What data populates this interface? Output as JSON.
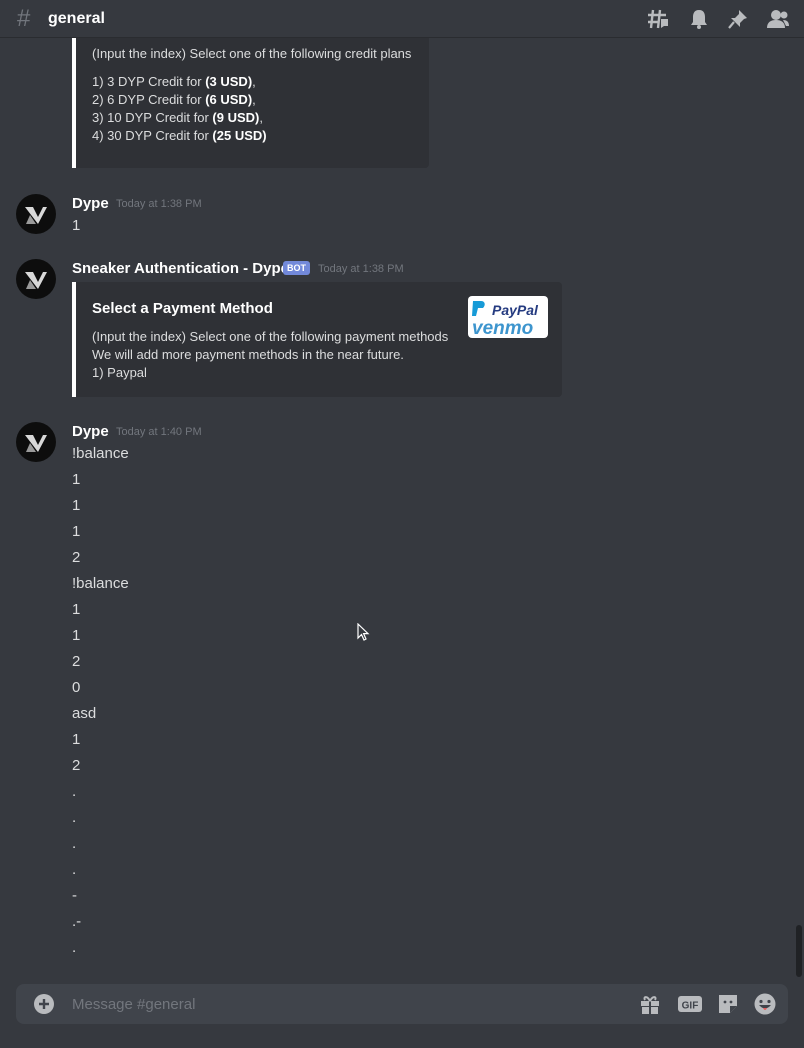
{
  "header": {
    "hash_symbol": "#",
    "channel": "general",
    "icons": [
      "threads-icon",
      "bell-icon",
      "pin-icon",
      "members-icon"
    ]
  },
  "embeds": {
    "credit_plans": {
      "lines": [
        "(Input the index) Select one of the following credit plans",
        "1) 3 DYP Credit for ",
        "(3 USD)",
        "2) 6 DYP Credit for ",
        "(6 USD)",
        "3) 10 DYP Credit for ",
        "(9 USD)",
        "4) 30 DYP Credit for ",
        "(25 USD)"
      ],
      "suffix": ","
    },
    "payment": {
      "title": "Select a Payment Method",
      "lines": [
        "(Input the index) Select one of the following payment methods",
        "We will add more payment methods in the near future.",
        "1) Paypal"
      ],
      "logo_text_1": "PayPal",
      "logo_text_2": "venmo"
    }
  },
  "messages": [
    {
      "author": "Dype",
      "timestamp": "Today at 1:38 PM",
      "lines": [
        "1"
      ]
    },
    {
      "author": "Sneaker Authentication - Dype",
      "bot_tag": "BOT",
      "timestamp": "Today at 1:38 PM"
    },
    {
      "author": "Dype",
      "timestamp": "Today at 1:40 PM",
      "lines": [
        "!balance",
        "1",
        "1",
        "1",
        "2",
        "!balance",
        "1",
        "1",
        "2",
        "0",
        "asd",
        "1",
        "2",
        ".",
        ".",
        ".",
        ".",
        "-",
        ".-",
        "."
      ]
    }
  ],
  "composer": {
    "placeholder": "Message #general",
    "gif_label": "GIF"
  },
  "colors": {
    "background": "#36393f",
    "embed_bg": "#2f3136",
    "composer_bg": "#40444b",
    "bot_tag": "#7289da",
    "muted": "#72767d"
  }
}
